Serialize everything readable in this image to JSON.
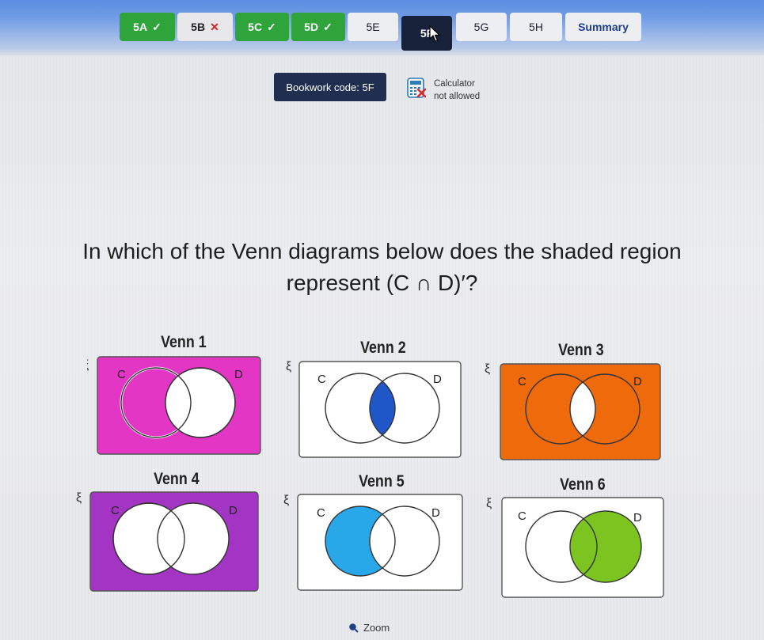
{
  "tabs": [
    {
      "label": "5A",
      "mark": "✓",
      "state": "done"
    },
    {
      "label": "5B",
      "mark": "✕",
      "state": "wrong"
    },
    {
      "label": "5C",
      "mark": "✓",
      "state": "done"
    },
    {
      "label": "5D",
      "mark": "✓",
      "state": "done"
    },
    {
      "label": "5E",
      "mark": "",
      "state": "todo"
    },
    {
      "label": "5F",
      "mark": "",
      "state": "current"
    },
    {
      "label": "5G",
      "mark": "",
      "state": "todo"
    },
    {
      "label": "5H",
      "mark": "",
      "state": "todo"
    },
    {
      "label": "Summary",
      "mark": "",
      "state": "summary"
    }
  ],
  "bookwork": {
    "label": "Bookwork code: 5F"
  },
  "calculator": {
    "line1": "Calculator",
    "line2": "not allowed"
  },
  "question": {
    "line1": "In which of the Venn diagrams below does the shaded region",
    "line2": "represent (C ∩ D)′?"
  },
  "venns": [
    {
      "title": "Venn 1",
      "universal": "ξ",
      "set_c": "C",
      "set_d": "D",
      "shaded": "outside intersection",
      "color": "#e336c5"
    },
    {
      "title": "Venn 2",
      "universal": "ξ",
      "set_c": "C",
      "set_d": "D",
      "shaded": "intersection",
      "color": "#1f57c8"
    },
    {
      "title": "Venn 3",
      "universal": "ξ",
      "set_c": "C",
      "set_d": "D",
      "shaded": "outside intersection",
      "color": "#ee6a0a"
    },
    {
      "title": "Venn 4",
      "universal": "ξ",
      "set_c": "C",
      "set_d": "D",
      "shaded": "outside both sets",
      "color": "#a334c4"
    },
    {
      "title": "Venn 5",
      "universal": "ξ",
      "set_c": "C",
      "set_d": "D",
      "shaded": "C only",
      "color": "#28a8e8"
    },
    {
      "title": "Venn 6",
      "universal": "ξ",
      "set_c": "C",
      "set_d": "D",
      "shaded": "D",
      "color": "#7cc41f"
    }
  ],
  "zoom": {
    "label": "Zoom"
  }
}
